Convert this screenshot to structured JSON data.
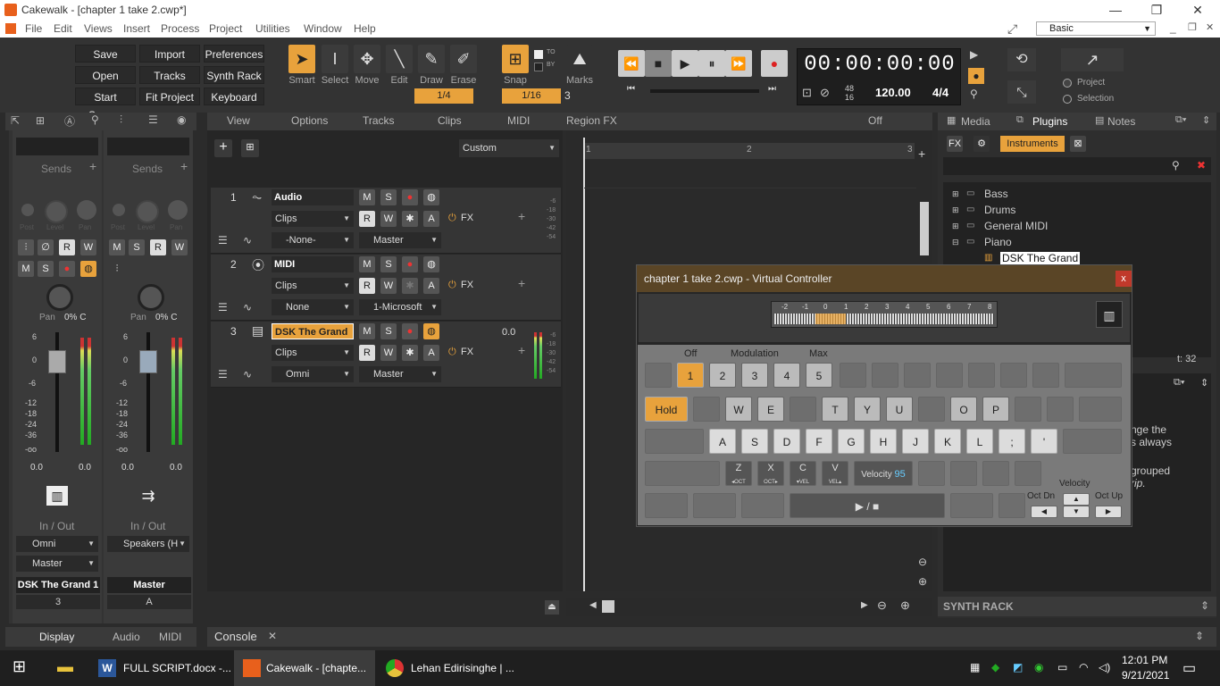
{
  "window": {
    "title": "Cakewalk - [chapter 1 take 2.cwp*]",
    "min": "—",
    "restore": "❐",
    "close": "✕"
  },
  "menu": [
    "File",
    "Edit",
    "Views",
    "Insert",
    "Process",
    "Project",
    "Utilities",
    "Window",
    "Help"
  ],
  "workspace": "Basic",
  "toolbar": {
    "buttons": [
      [
        "Save",
        "Import",
        "Preferences"
      ],
      [
        "Open",
        "Tracks",
        "Synth Rack"
      ],
      [
        "Start Screen",
        "Fit Project",
        "Keyboard"
      ]
    ],
    "tools": [
      "Smart",
      "Select",
      "Move",
      "Edit",
      "Draw",
      "Erase"
    ],
    "smart_value": "1/4",
    "snap_label": "Snap",
    "snap_value": "1/16",
    "snap_num": "3",
    "snap_to": "TO",
    "snap_by": "BY",
    "marks_label": "Marks",
    "time": "00:00:00:00",
    "tempo": "120.00",
    "meter": "4/4",
    "meter_top": "48",
    "meter_bot": "16",
    "project_label": "Project",
    "selection_label": "Selection"
  },
  "trackview": {
    "menus": [
      "View",
      "Options",
      "Tracks",
      "Clips",
      "MIDI",
      "Region FX"
    ],
    "off": "Off",
    "custom": "Custom",
    "ruler": [
      "1",
      "2",
      "3"
    ],
    "tracks": [
      {
        "num": "1",
        "name": "Audio",
        "clips": "Clips",
        "input": "-None-",
        "output": "Master",
        "fx": "FX",
        "scale": [
          "-6",
          "-18",
          "-30",
          "-42",
          "-54"
        ]
      },
      {
        "num": "2",
        "name": "MIDI",
        "clips": "Clips",
        "input": "None",
        "output": "1-Microsoft",
        "fx": "FX"
      },
      {
        "num": "3",
        "name": "DSK The Grand",
        "clips": "Clips",
        "input": "Omni",
        "output": "Master",
        "fx": "FX",
        "value": "0.0",
        "scale": [
          "-6",
          "-18",
          "-30",
          "-42",
          "-54"
        ]
      }
    ],
    "btn_m": "M",
    "btn_s": "S",
    "btn_r": "R",
    "btn_w": "W",
    "btn_a": "A"
  },
  "console": {
    "tab": "Console"
  },
  "mixer": {
    "strips": [
      {
        "sends": "Sends",
        "pan": "Pan",
        "pan_val": "0% C",
        "vol_l": "0.0",
        "vol_r": "0.0",
        "io": "In / Out",
        "in": "Omni",
        "out": "Master",
        "name": "DSK The Grand 1",
        "num": "3"
      },
      {
        "sends": "Sends",
        "pan": "Pan",
        "pan_val": "0% C",
        "vol_l": "0.0",
        "vol_r": "0.0",
        "io": "In / Out",
        "in": "Speakers (H",
        "out": "",
        "name": "Master",
        "num": "A"
      }
    ],
    "knob_labels": [
      "Post",
      "Level",
      "Pan"
    ],
    "scale": [
      "6",
      "0",
      "-6",
      "-12",
      "-18",
      "-24",
      "-36",
      "-oo"
    ],
    "tabs": [
      "Display",
      "Audio",
      "MIDI"
    ]
  },
  "browser": {
    "tabs": [
      "Media",
      "Plugins",
      "Notes"
    ],
    "instruments": "Instruments",
    "tree": [
      "Bass",
      "Drums",
      "General MIDI",
      "Piano",
      "DSK The Grand"
    ],
    "count": "t: 32",
    "hint1": "nge the",
    "hint2": "s always",
    "hint3": "grouped",
    "hint4": "rip.",
    "synth_rack": "SYNTH RACK"
  },
  "vc": {
    "title": "chapter 1 take 2.cwp - Virtual Controller",
    "octaves": [
      "-2",
      "-1",
      "0",
      "1",
      "2",
      "3",
      "4",
      "5",
      "6",
      "7",
      "8"
    ],
    "off": "Off",
    "modulation": "Modulation",
    "max": "Max",
    "mod_keys": [
      "1",
      "2",
      "3",
      "4",
      "5"
    ],
    "hold": "Hold",
    "row_w": [
      "W",
      "E",
      "T",
      "Y",
      "U",
      "O",
      "P"
    ],
    "row_a": [
      "A",
      "S",
      "D",
      "F",
      "G",
      "H",
      "J",
      "K",
      "L",
      ";",
      "'"
    ],
    "row_z": [
      {
        "k": "Z",
        "s": "◂OCT"
      },
      {
        "k": "X",
        "s": "OCT▸"
      },
      {
        "k": "C",
        "s": "▾VEL"
      },
      {
        "k": "V",
        "s": "VEL▴"
      }
    ],
    "velocity_label": "Velocity",
    "velocity_val": "95",
    "play": "▶ / ■",
    "oct_dn": "Oct Dn",
    "oct_up": "Oct Up",
    "velocity2": "Velocity"
  },
  "taskbar": {
    "apps": [
      "FULL SCRIPT.docx -...",
      "Cakewalk - [chapte...",
      "Lehan Edirisinghe | ..."
    ],
    "time": "12:01 PM",
    "date": "9/21/2021"
  }
}
